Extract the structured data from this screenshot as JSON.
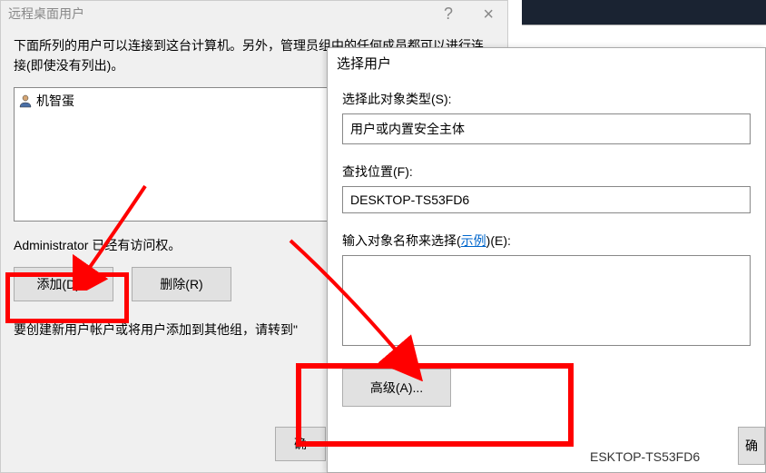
{
  "leftDialog": {
    "title": "远程桌面用户",
    "description": "下面所列的用户可以连接到这台计算机。另外，管理员组中的任何成员都可以进行连接(即使没有列出)。",
    "userItem": "机智蛋",
    "accessNote": "Administrator 已经有访问权。",
    "addBtn": "添加(D)...",
    "deleteBtn": "删除(R)",
    "createNote": "要创建新用户帐户或将用户添加到其他组，请转到\"",
    "okBtn": "确"
  },
  "rightDialog": {
    "title": "选择用户",
    "objectTypeLabel": "选择此对象类型(S):",
    "objectTypeValue": "用户或内置安全主体",
    "locationLabel": "查找位置(F):",
    "locationValue": "DESKTOP-TS53FD6",
    "objectNameLabel1": "输入对象名称来选择(",
    "objectNameLink": "示例",
    "objectNameLabel2": ")(E):",
    "advancedBtn": "高级(A)...",
    "confirmBtn": "确"
  },
  "bottomText": "ESKTOP-TS53FD6"
}
